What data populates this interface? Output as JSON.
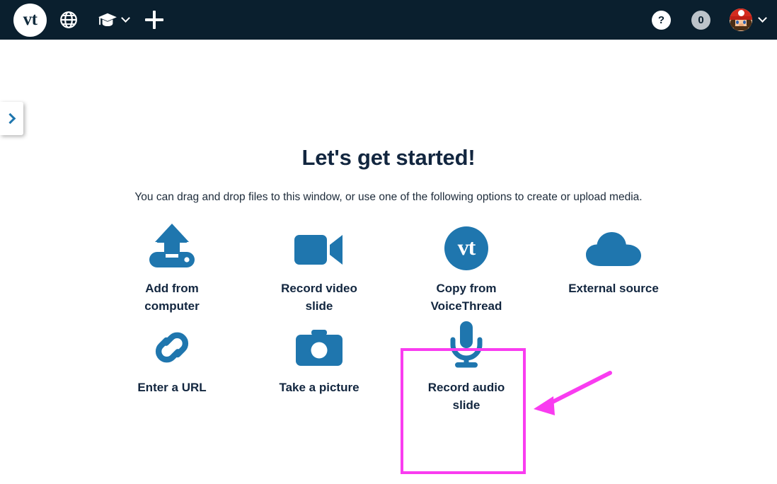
{
  "topbar": {
    "logo_text": "vt",
    "logo_name": "voicethread-logo",
    "items": [
      {
        "name": "globe-icon",
        "label": "Browse"
      },
      {
        "name": "graduation-cap-icon",
        "label": "Courses"
      },
      {
        "name": "plus-icon",
        "label": "Create"
      }
    ],
    "help_label": "?",
    "notification_count": "0",
    "avatar_alt": "User avatar",
    "chevron_label": "⌄"
  },
  "sidebar_handle": {
    "name": "expand-sidebar-handle",
    "glyph": "›"
  },
  "main": {
    "headline": "Let's get started!",
    "subhead": "You can drag and drop files to this window, or use one of the following options to create or upload media.",
    "options": [
      {
        "id": "add-from-computer",
        "icon": "upload-icon",
        "label": "Add from\ncomputer"
      },
      {
        "id": "record-video-slide",
        "icon": "video-camera-icon",
        "label": "Record video\nslide"
      },
      {
        "id": "copy-from-voicethread",
        "icon": "voicethread-icon",
        "label": "Copy from\nVoiceThread"
      },
      {
        "id": "external-source",
        "icon": "cloud-icon",
        "label": "External source"
      },
      {
        "id": "enter-a-url",
        "icon": "link-icon",
        "label": "Enter a URL"
      },
      {
        "id": "take-a-picture",
        "icon": "camera-icon",
        "label": "Take a picture"
      },
      {
        "id": "record-audio-slide",
        "icon": "microphone-icon",
        "label": "Record audio\nslide"
      }
    ]
  },
  "annotation": {
    "highlight_target": "record-audio-slide",
    "box_color": "#f93cf0",
    "arrow_color": "#f93cf0"
  },
  "colors": {
    "header_bg": "#0a1f2e",
    "accent_blue": "#1f76ae",
    "text_dark": "#12263f",
    "badge_gray": "#bcc3c9",
    "page_bg": "#ffffff"
  }
}
